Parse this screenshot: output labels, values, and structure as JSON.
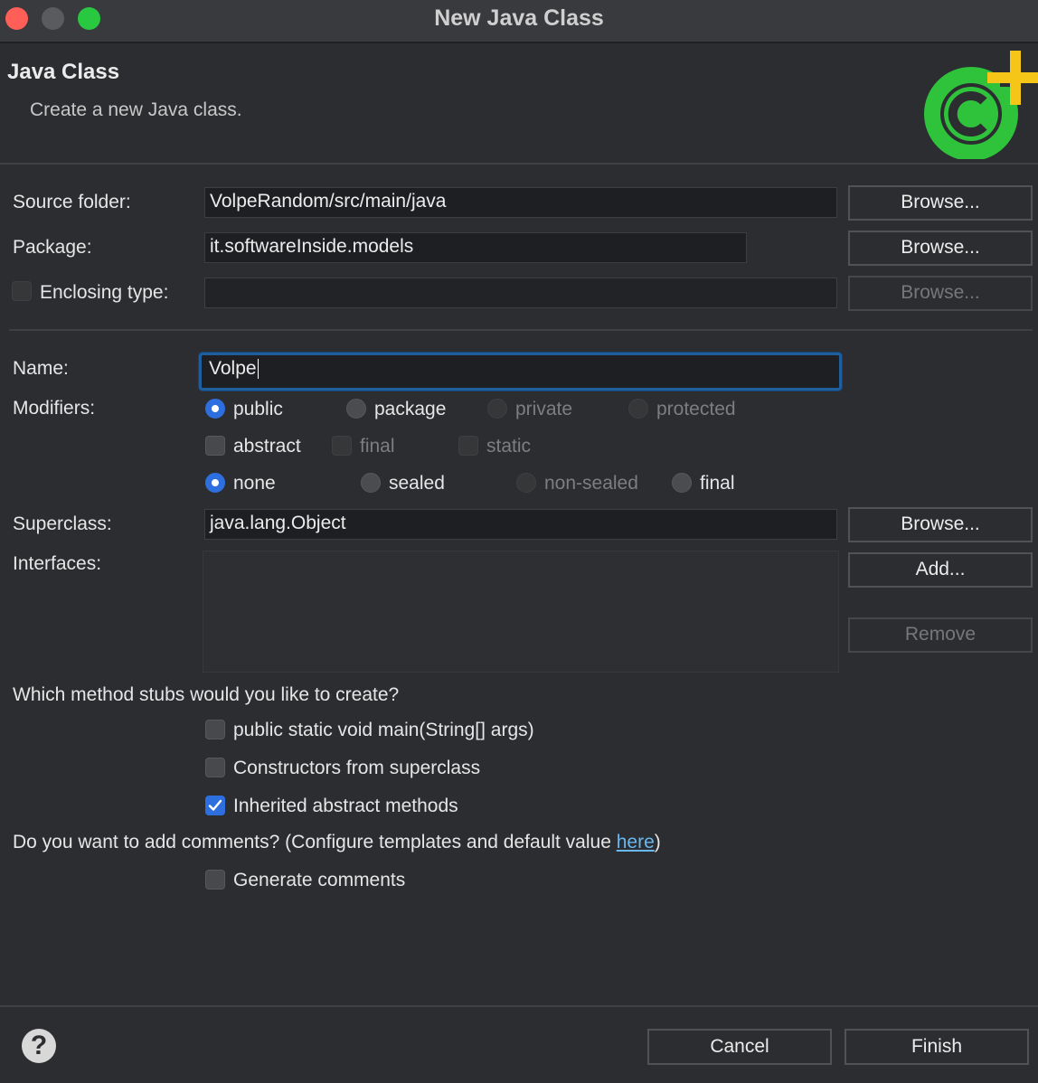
{
  "window": {
    "title": "New Java Class"
  },
  "header": {
    "title": "Java Class",
    "subtitle": "Create a new Java class."
  },
  "source_folder": {
    "label": "Source folder:",
    "value": "VolpeRandom/src/main/java",
    "browse": "Browse..."
  },
  "package": {
    "label": "Package:",
    "value": "it.softwareInside.models",
    "browse": "Browse..."
  },
  "enclosing": {
    "label": "Enclosing type:",
    "value": "",
    "browse": "Browse...",
    "checked": false
  },
  "name": {
    "label": "Name:",
    "value": "Volpe"
  },
  "modifiers": {
    "label": "Modifiers:",
    "row1": [
      "public",
      "package",
      "private",
      "protected"
    ],
    "row1_selected": "public",
    "row2": [
      "abstract",
      "final",
      "static"
    ],
    "row3": [
      "none",
      "sealed",
      "non-sealed",
      "final"
    ],
    "row3_selected": "none"
  },
  "superclass": {
    "label": "Superclass:",
    "value": "java.lang.Object",
    "browse": "Browse..."
  },
  "interfaces": {
    "label": "Interfaces:",
    "add": "Add...",
    "remove": "Remove"
  },
  "stubs": {
    "question": "Which method stubs would you like to create?",
    "options": [
      {
        "label": "public static void main(String[] args)",
        "checked": false
      },
      {
        "label": "Constructors from superclass",
        "checked": false
      },
      {
        "label": "Inherited abstract methods",
        "checked": true
      }
    ]
  },
  "comments": {
    "question_prefix": "Do you want to add comments? (Configure templates and default value ",
    "link": "here",
    "question_suffix": ")",
    "generate": "Generate comments",
    "generate_checked": false
  },
  "footer": {
    "help": "?",
    "cancel": "Cancel",
    "finish": "Finish"
  },
  "colors": {
    "accent": "#2e6fe0",
    "icon_green": "#2fc33c",
    "icon_plus": "#f5c518",
    "link": "#68b8f2"
  }
}
